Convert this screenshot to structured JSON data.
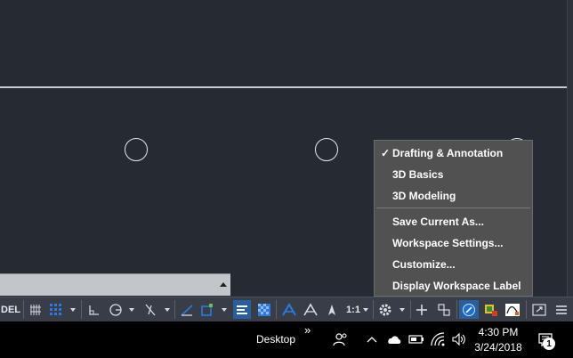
{
  "statusbar": {
    "model_label": "DEL",
    "scale_label": "1:1",
    "items": [
      "grid-icon",
      "snap-icon",
      "ortho-icon",
      "polar-icon",
      "isodraft-icon",
      "dynamic-ucs-icon",
      "selection-icon",
      "lineweight-icon",
      "transparency-icon",
      "annotation-icon",
      "autoscale-icon",
      "visibility-icon",
      "workspace-gear-icon",
      "plus-icon",
      "isolate-icon",
      "hardware-icon",
      "quickprops-icon",
      "clean-screen-icon",
      "customize-icon"
    ]
  },
  "workspace_menu": {
    "items": [
      {
        "label": "Drafting & Annotation",
        "checked": true
      },
      {
        "label": "3D Basics",
        "checked": false
      },
      {
        "label": "3D Modeling",
        "checked": false
      },
      {
        "label": "Save Current As...",
        "checked": false
      },
      {
        "label": "Workspace Settings...",
        "checked": false
      },
      {
        "label": "Customize...",
        "checked": false
      },
      {
        "label": "Display Workspace Label",
        "checked": false
      }
    ],
    "check_glyph": "✓"
  },
  "taskbar": {
    "desktop_label": "Desktop",
    "chevron": "»",
    "time": "4:30 PM",
    "date": "3/24/2018",
    "notification_count": "1"
  },
  "colors": {
    "canvas": "#252a33",
    "menu_bg": "#515151",
    "statusbar_bg": "#383d47",
    "active_blue": "#2a7ae2"
  }
}
